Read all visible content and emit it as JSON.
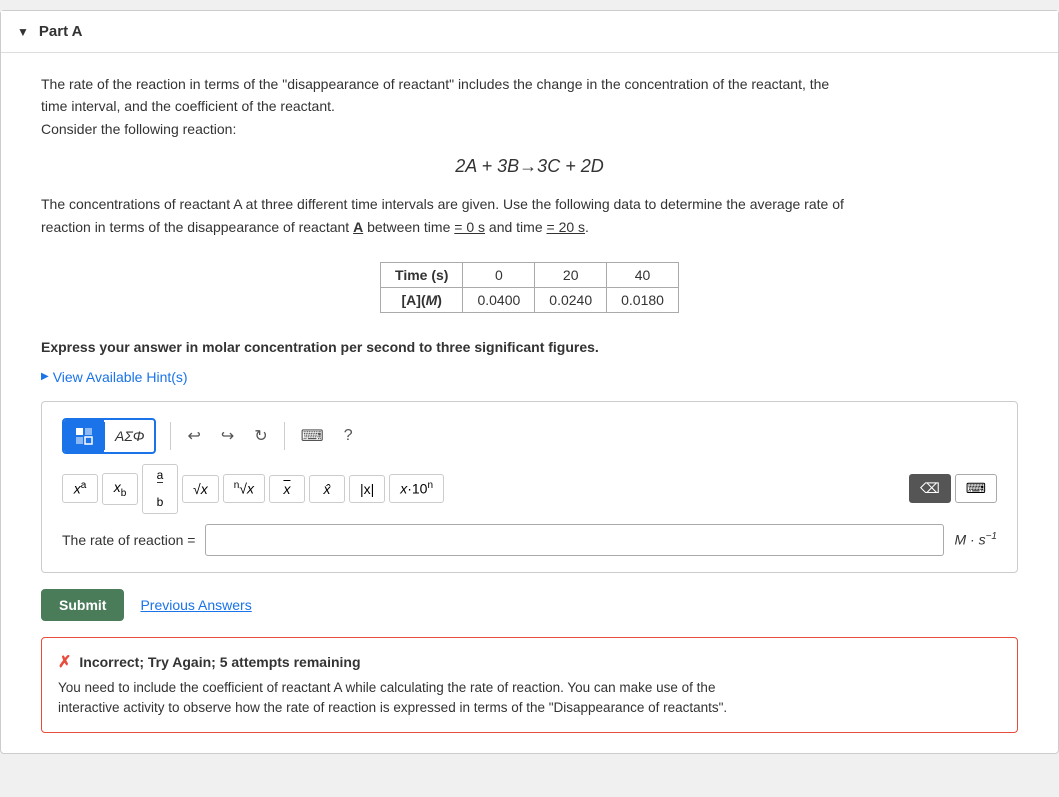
{
  "part": {
    "title": "Part A",
    "collapse_icon": "▼"
  },
  "description": {
    "line1": "The rate of the reaction in terms of the \"disappearance of reactant\" includes the change in the concentration of the reactant, the",
    "line2": "time interval, and the coefficient of the reactant.",
    "line3": "Consider the following reaction:"
  },
  "equation": "2A + 3B→3C + 2D",
  "concentration_text": {
    "line1": "The concentrations of reactant A at three different time intervals are given. Use the following data to determine the average rate of",
    "line2": "reaction in terms of the disappearance of reactant A between time = 0 s  and time = 20 s."
  },
  "table": {
    "headers": [
      "Time (s)",
      "0",
      "20",
      "40"
    ],
    "row_label": "[A](M)",
    "row_values": [
      "0.0400",
      "0.0240",
      "0.0180"
    ]
  },
  "instruction": "Express your answer in molar concentration per second to three significant figures.",
  "hint_link": "View Available Hint(s)",
  "toolbar": {
    "template_btn": "▣",
    "template_label": "▣",
    "greek_label": "ΑΣΦ",
    "undo_icon": "↩",
    "redo_icon": "↪",
    "refresh_icon": "↻",
    "keyboard_icon": "⌨",
    "help_icon": "?"
  },
  "math_buttons": [
    {
      "label": "xª",
      "id": "superscript"
    },
    {
      "label": "x_b",
      "id": "subscript"
    },
    {
      "label": "a/b",
      "id": "fraction"
    },
    {
      "label": "√x",
      "id": "sqrt"
    },
    {
      "label": "ⁿ√x",
      "id": "nthroot"
    },
    {
      "label": "x̄",
      "id": "overline"
    },
    {
      "label": "x̂",
      "id": "hat"
    },
    {
      "label": "|x|",
      "id": "abs"
    },
    {
      "label": "x·10ⁿ",
      "id": "sci-notation"
    }
  ],
  "delete_btn": "⌫",
  "keyboard_btn": "⌨",
  "input": {
    "label": "The rate of reaction =",
    "placeholder": "",
    "unit": "M·s⁻¹"
  },
  "actions": {
    "submit_label": "Submit",
    "previous_answers_label": "Previous Answers"
  },
  "error": {
    "icon": "✗",
    "title": "Incorrect; Try Again; 5 attempts remaining",
    "line1": "You need to include the coefficient of reactant A while calculating the rate of reaction. You can make use of the",
    "line2": "interactive activity to observe how the rate of reaction is expressed in terms of the \"Disappearance of reactants\"."
  }
}
